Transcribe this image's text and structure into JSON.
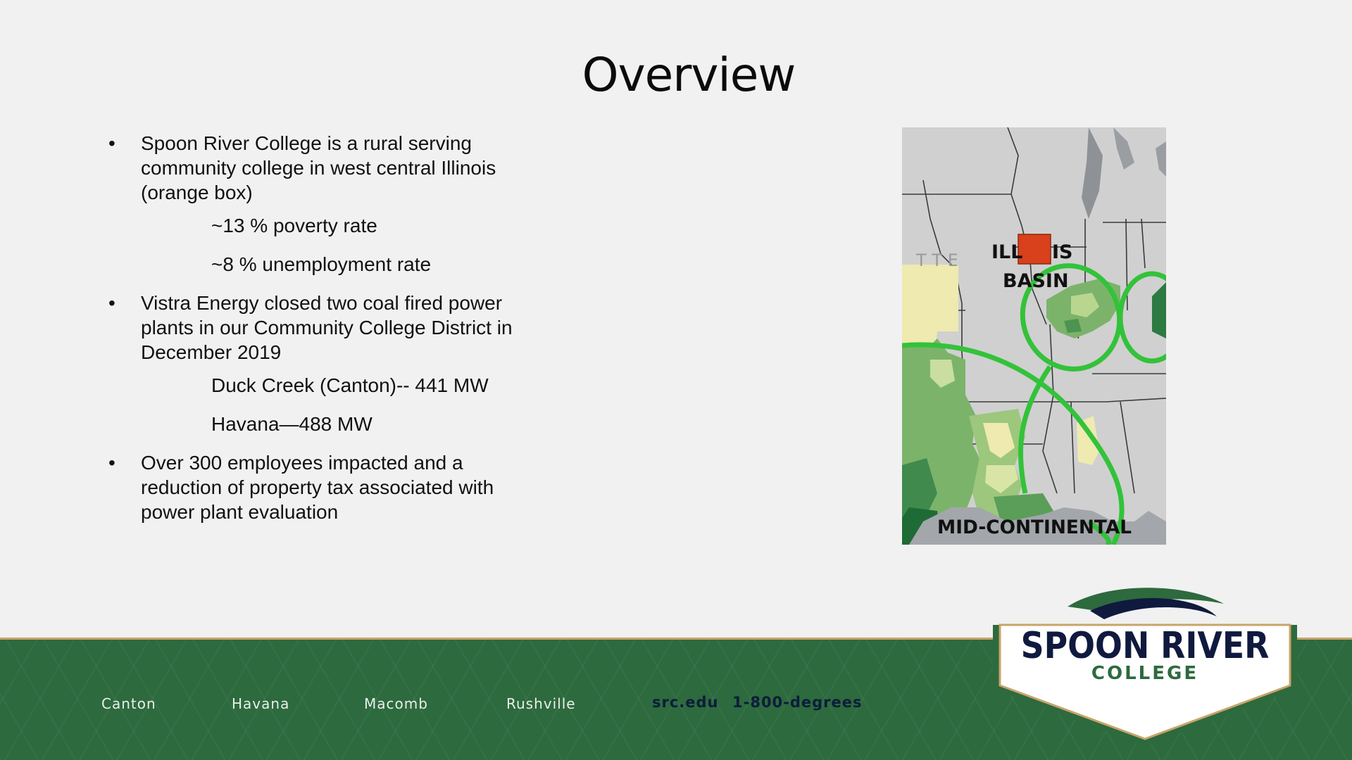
{
  "slide": {
    "title": "Overview",
    "bullets": [
      {
        "text": "Spoon River College is a rural serving community college in west central Illinois (orange box)",
        "subs": [
          "~13 % poverty rate",
          "~8 % unemployment rate"
        ]
      },
      {
        "text": "Vistra Energy closed two coal fired power plants in our Community College District in December 2019",
        "subs": [
          "Duck Creek (Canton)-- 441 MW",
          "Havana—488 MW"
        ]
      },
      {
        "text": "Over 300 employees impacted and a reduction of property tax associated with power plant evaluation",
        "subs": []
      }
    ],
    "bullet_symbol": "•"
  },
  "map": {
    "label_line1_left": "ILL",
    "label_line1_right": "IS",
    "label_line2": "BASIN",
    "label_bottom": "MID-CONTINENTAL",
    "faint_text": "T   T E",
    "highlight_color": "#d9401c"
  },
  "footer": {
    "locations": [
      "Canton",
      "Havana",
      "Macomb",
      "Rushville"
    ],
    "website": "src.edu",
    "phone": "1-800-degrees"
  },
  "logo": {
    "name": "SPOON RIVER",
    "sub": "COLLEGE"
  },
  "colors": {
    "brand_green": "#2d6a3e",
    "brand_navy": "#0f1a3e",
    "gold": "#c8a46a"
  }
}
